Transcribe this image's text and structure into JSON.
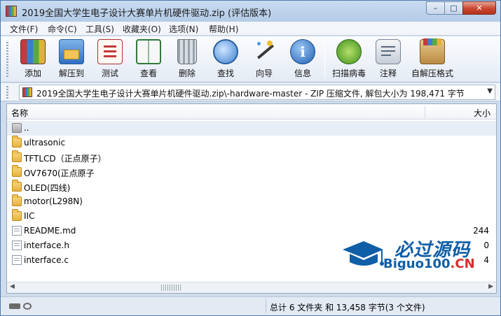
{
  "window": {
    "title": "2019全国大学生电子设计大赛单片机硬件驱动.zip (评估版本)",
    "controls": {
      "minimize": "–",
      "maximize": "□",
      "close": "✕"
    }
  },
  "menu": [
    "文件(F)",
    "命令(C)",
    "工具(S)",
    "收藏夹(O)",
    "选项(N)",
    "帮助(H)"
  ],
  "toolbar": [
    {
      "label": "添加",
      "icon": "add-icon"
    },
    {
      "label": "解压到",
      "icon": "extract-icon"
    },
    {
      "label": "测试",
      "icon": "test-icon"
    },
    {
      "label": "查看",
      "icon": "view-icon"
    },
    {
      "label": "删除",
      "icon": "delete-icon"
    },
    {
      "label": "查找",
      "icon": "find-icon"
    },
    {
      "label": "向导",
      "icon": "wizard-icon"
    },
    {
      "label": "信息",
      "icon": "info-icon"
    },
    {
      "label": "扫描病毒",
      "icon": "virus-scan-icon"
    },
    {
      "label": "注释",
      "icon": "comment-icon"
    },
    {
      "label": "自解压格式",
      "icon": "sfx-icon"
    }
  ],
  "address": {
    "path": "2019全国大学生电子设计大赛单片机硬件驱动.zip\\-hardware-master - ZIP 压缩文件, 解包大小为 198,471 字节"
  },
  "columns": {
    "name": "名称",
    "size": "大小"
  },
  "files": [
    {
      "name": "..",
      "size": "",
      "type": "up"
    },
    {
      "name": "ultrasonic",
      "size": "",
      "type": "folder"
    },
    {
      "name": "TFTLCD（正点原子）",
      "size": "",
      "type": "folder"
    },
    {
      "name": "OV7670(正点原子",
      "size": "",
      "type": "folder"
    },
    {
      "name": "OLED(四线)",
      "size": "",
      "type": "folder"
    },
    {
      "name": "motor(L298N)",
      "size": "",
      "type": "folder"
    },
    {
      "name": "IIC",
      "size": "",
      "type": "folder"
    },
    {
      "name": "README.md",
      "size": "244",
      "type": "file"
    },
    {
      "name": "interface.h",
      "size": "0",
      "type": "file"
    },
    {
      "name": "interface.c",
      "size": "4",
      "type": "file"
    }
  ],
  "watermark": {
    "title": "必过源码",
    "sub_main": "Biguo100",
    "sub_tld": ".CN"
  },
  "status": {
    "summary": "总计 6 文件夹 和 13,458 字节(3 个文件)"
  },
  "colors": {
    "title_bar": "#b3cbe7",
    "close_button": "#c9462e",
    "watermark": "#0f5ea8"
  }
}
